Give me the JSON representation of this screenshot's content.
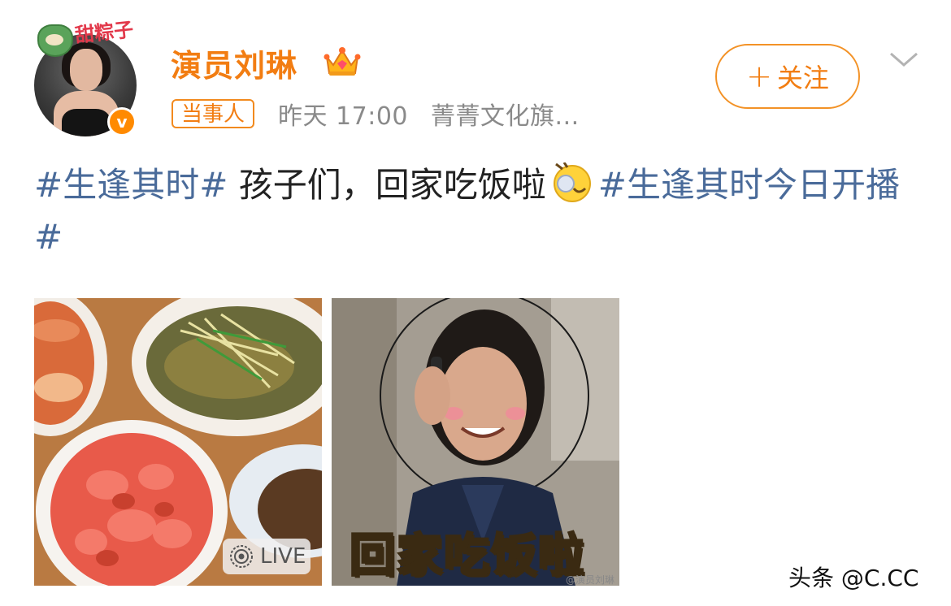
{
  "header": {
    "avatar_tag": "甜粽子",
    "username": "演员刘琳",
    "role_badge": "当事人",
    "time": "昨天 17:00",
    "source": "菁菁文化旗...",
    "follow_label": "关注",
    "verified_mark": "v"
  },
  "post": {
    "hashtag1": "#生逢其时#",
    "text1": " 孩子们，回家吃饭啦",
    "hashtag2": "#生逢其时今日开播#"
  },
  "images": {
    "live_label": "LIVE",
    "caption": "回家吃饭啦",
    "image_watermark": "@演员刘琳"
  },
  "watermark": "头条 @C.CC",
  "colors": {
    "accent_orange": "#f27d12",
    "hashtag_blue": "#4a6b9a",
    "meta_gray": "#8a8a8a"
  }
}
